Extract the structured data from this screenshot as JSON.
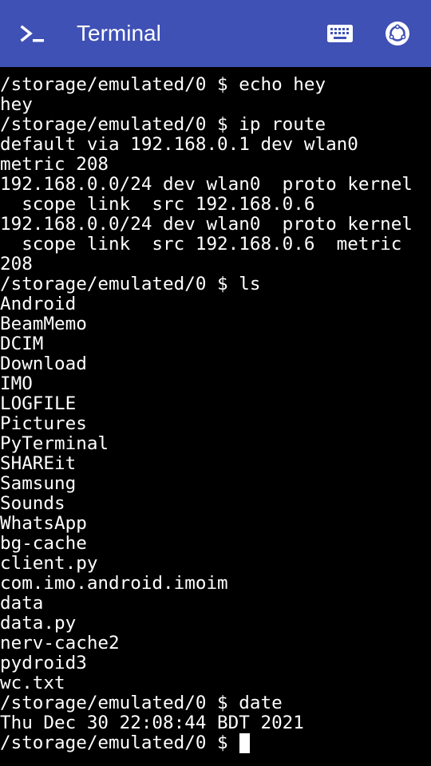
{
  "appbar": {
    "title": "Terminal",
    "icons": {
      "app": "terminal-prompt-icon",
      "keyboard": "keyboard-icon",
      "settings": "settings-icon"
    },
    "colors": {
      "background": "#3f51b5",
      "foreground": "#ffffff"
    }
  },
  "terminal": {
    "colors": {
      "background": "#000000",
      "foreground": "#ffffff"
    },
    "lines": [
      "/storage/emulated/0 $ echo hey",
      "hey",
      "/storage/emulated/0 $ ip route",
      "default via 192.168.0.1 dev wlan0",
      "metric 208",
      "192.168.0.0/24 dev wlan0  proto kernel",
      "  scope link  src 192.168.0.6",
      "192.168.0.0/24 dev wlan0  proto kernel",
      "  scope link  src 192.168.0.6  metric",
      "208",
      "/storage/emulated/0 $ ls",
      "Android",
      "BeamMemo",
      "DCIM",
      "Download",
      "IMO",
      "LOGFILE",
      "Pictures",
      "PyTerminal",
      "SHAREit",
      "Samsung",
      "Sounds",
      "WhatsApp",
      "bg-cache",
      "client.py",
      "com.imo.android.imoim",
      "data",
      "data.py",
      "nerv-cache2",
      "pydroid3",
      "wc.txt",
      "/storage/emulated/0 $ date",
      "Thu Dec 30 22:08:44 BDT 2021"
    ],
    "current_prompt": "/storage/emulated/0 $ "
  }
}
